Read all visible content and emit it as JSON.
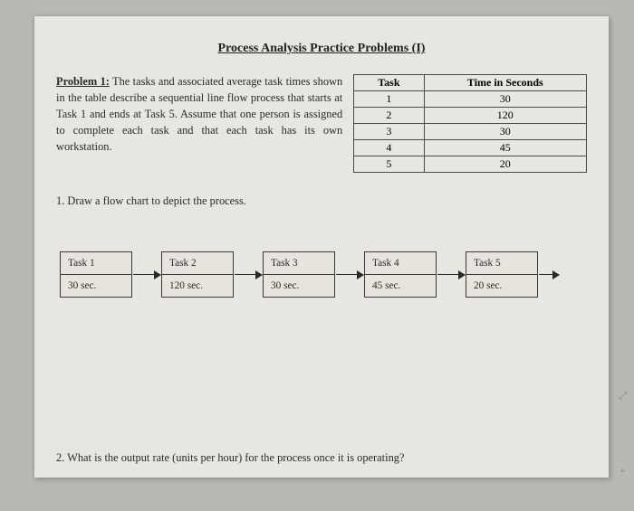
{
  "title": "Process Analysis Practice Problems (I)",
  "problem": {
    "label": "Problem 1:",
    "text": " The tasks and associated average task times shown in the table describe a sequential line flow process that starts at Task 1 and ends at Task 5. Assume that one person is assigned to complete each task and that each task has its own workstation."
  },
  "table": {
    "headers": {
      "c1": "Task",
      "c2": "Time in Seconds"
    },
    "rows": [
      {
        "task": "1",
        "time": "30"
      },
      {
        "task": "2",
        "time": "120"
      },
      {
        "task": "3",
        "time": "30"
      },
      {
        "task": "4",
        "time": "45"
      },
      {
        "task": "5",
        "time": "20"
      }
    ]
  },
  "q1": "1. Draw a flow chart to depict the process.",
  "flow": [
    {
      "name": "Task 1",
      "time": "30 sec."
    },
    {
      "name": "Task 2",
      "time": "120 sec."
    },
    {
      "name": "Task 3",
      "time": "30 sec."
    },
    {
      "name": "Task 4",
      "time": "45 sec."
    },
    {
      "name": "Task 5",
      "time": "20 sec."
    }
  ],
  "q2": "2. What is the output rate (units per hour) for the process once it is operating?",
  "icons": {
    "expand": "⤢",
    "plus": "+"
  }
}
